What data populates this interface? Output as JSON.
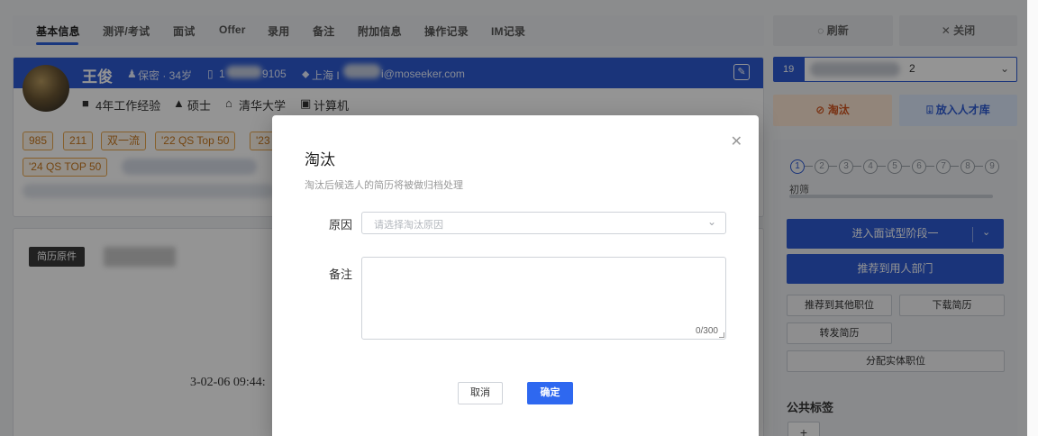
{
  "tabs": [
    {
      "label": "基本信息",
      "active": true
    },
    {
      "label": "测评/考试"
    },
    {
      "label": "面试"
    },
    {
      "label": "Offer"
    },
    {
      "label": "录用"
    },
    {
      "label": "备注"
    },
    {
      "label": "附加信息"
    },
    {
      "label": "操作记录"
    },
    {
      "label": "IM记录"
    }
  ],
  "toolbar": {
    "refresh": "◌ 刷新",
    "close": "✕ 关闭"
  },
  "candidate": {
    "name": "王俊",
    "gender_age": "保密 · 34岁",
    "phone_start": "1",
    "phone_end": "9105",
    "location": "上海 I",
    "email_suffix": "i@moseeker.com",
    "experience": "4年工作经验",
    "degree": "硕士",
    "school": "清华大学",
    "major": "计算机"
  },
  "tags": [
    "985",
    "211",
    "双一流",
    "'22 QS Top 50",
    "'23",
    "'24 QS TOP 50"
  ],
  "resume": {
    "original_label": "简历原件",
    "date_fragment": "3-02-06 09:44:"
  },
  "position_select": {
    "badge": "19",
    "text": "2"
  },
  "actions": {
    "reject": "淘汰",
    "talent_pool": "放入人才库",
    "advance": "进入面试型阶段一",
    "recommend_dept": "推荐到用人部门",
    "recommend_other": "推荐到其他职位",
    "download_resume": "下载简历",
    "forward_resume": "转发简历",
    "assign_position": "分配实体职位"
  },
  "stages": {
    "steps": [
      "1",
      "2",
      "3",
      "4",
      "5",
      "6",
      "7",
      "8",
      "9"
    ],
    "current_label": "初筛"
  },
  "public_tags": {
    "title": "公共标签",
    "add": "+"
  },
  "modal": {
    "title": "淘汰",
    "subtitle": "淘汰后候选人的简历将被做归档处理",
    "reason_label": "原因",
    "reason_placeholder": "请选择淘汰原因",
    "remark_label": "备注",
    "remark_count": "0/300",
    "cancel": "取消",
    "confirm": "确定"
  }
}
